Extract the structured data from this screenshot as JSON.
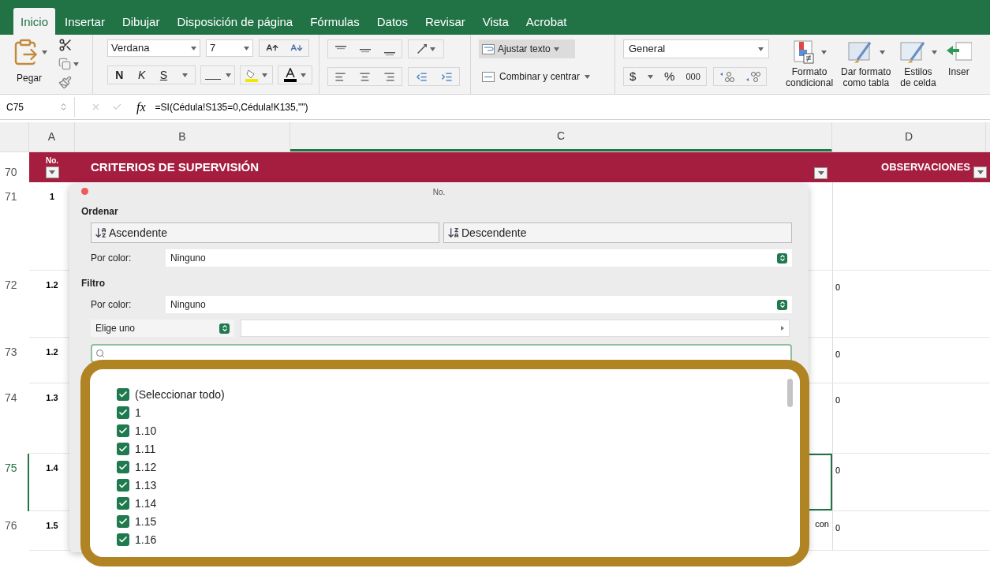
{
  "ribbon": {
    "tabs": [
      {
        "label": "Inicio",
        "selected": true
      },
      {
        "label": "Insertar",
        "selected": false
      },
      {
        "label": "Dibujar",
        "selected": false
      },
      {
        "label": "Disposición de página",
        "selected": false
      },
      {
        "label": "Fórmulas",
        "selected": false
      },
      {
        "label": "Datos",
        "selected": false
      },
      {
        "label": "Revisar",
        "selected": false
      },
      {
        "label": "Vista",
        "selected": false
      },
      {
        "label": "Acrobat",
        "selected": false
      }
    ],
    "paste": "Pegar",
    "font_name": "Verdana",
    "font_size": "7",
    "bold": "N",
    "italic": "K",
    "underline": "S",
    "wrap_text": {
      "label": "Ajustar texto",
      "on": true
    },
    "merge": "Combinar y centrar",
    "number_format": "General",
    "currency": "$",
    "percent": "%",
    "thousands": "000",
    "big_buttons": [
      {
        "kind": "conditional",
        "lines": [
          "Formato",
          "condicional"
        ]
      },
      {
        "kind": "table",
        "lines": [
          "Dar formato",
          "como tabla"
        ]
      },
      {
        "kind": "styles",
        "lines": [
          "Estilos",
          "de celda"
        ]
      },
      {
        "kind": "insert",
        "lines": [
          "Inser"
        ]
      }
    ]
  },
  "formula_bar": {
    "cell": "C75",
    "fx": "fx",
    "formula": "=SI(Cédula!S135=0,Cédula!K135,\"\")"
  },
  "sheet": {
    "columns": [
      {
        "label": "A",
        "selected": false
      },
      {
        "label": "B",
        "selected": false
      },
      {
        "label": "C",
        "selected": true
      },
      {
        "label": "D",
        "selected": false
      }
    ],
    "header_row": {
      "row": "70",
      "no": "No.",
      "criteria": "CRITERIOS DE SUPERVISIÓN",
      "observations": "OBSERVACIONES"
    },
    "rows": [
      {
        "row": "71",
        "no": "1",
        "selected": false
      },
      {
        "row": "72",
        "no": "1.2",
        "d": "0",
        "selected": false
      },
      {
        "row": "73",
        "no": "1.2",
        "d": "0",
        "selected": false
      },
      {
        "row": "74",
        "no": "1.3",
        "d": "0",
        "selected": false
      },
      {
        "row": "75",
        "no": "1.4",
        "d": "0",
        "selected": true
      },
      {
        "row": "76",
        "no": "1.5",
        "c": "con",
        "d": "0",
        "selected": false
      }
    ]
  },
  "filter_popup": {
    "title": "No.",
    "sort_heading": "Ordenar",
    "ascending": "Ascendente",
    "descending": "Descendente",
    "sort_color_label": "Por color:",
    "sort_color": "Ninguno",
    "filter_heading": "Filtro",
    "filter_color_label": "Por color:",
    "filter_color": "Ninguno",
    "condition": "Elige uno",
    "items": [
      {
        "label": "(Seleccionar todo)",
        "checked": true
      },
      {
        "label": "1",
        "checked": true
      },
      {
        "label": "1.10",
        "checked": true
      },
      {
        "label": "1.11",
        "checked": true
      },
      {
        "label": "1.12",
        "checked": true
      },
      {
        "label": "1.13",
        "checked": true
      },
      {
        "label": "1.14",
        "checked": true
      },
      {
        "label": "1.15",
        "checked": true
      },
      {
        "label": "1.16",
        "checked": true
      }
    ]
  }
}
